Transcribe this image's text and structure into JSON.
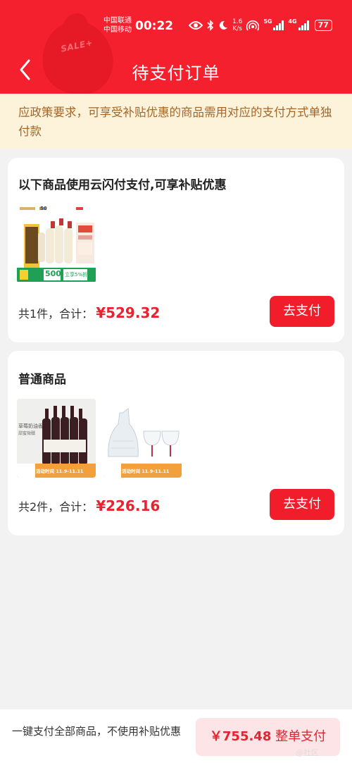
{
  "status_bar": {
    "carrier_1": "中国联通",
    "carrier_2": "中国移动",
    "time": "00:22",
    "speed_value": "1.6",
    "speed_unit": "K/s",
    "net_1": "5G",
    "net_2": "4G",
    "battery": "77"
  },
  "header": {
    "title": "待支付订单",
    "deco_text": "SALE+"
  },
  "notice": {
    "text": "应政策要求，可享受补贴优惠的商品需用对应的支付方式单独付款"
  },
  "orders": [
    {
      "title": "以下商品使用云闪付支付,可享补贴优惠",
      "count_text": "共1件，合计：",
      "price": "¥529.32",
      "pay_label": "去支付",
      "products": [
        {
          "badge_1": "50",
          "promo_1": "500",
          "promo_2": "立享5%折"
        }
      ]
    },
    {
      "title": "普通商品",
      "count_text": "共2件，合计：",
      "price": "¥226.16",
      "pay_label": "去支付",
      "products": [
        {
          "label_top": "草莓奶油香",
          "label_sub": "甜蜜微醺",
          "tag": "活动时间 11.9-11.11"
        },
        {
          "tag": "活动时间 11.9-11.11"
        }
      ]
    }
  ],
  "bottom": {
    "description": "一键支付全部商品，不使用补贴优惠",
    "total": "￥755.48",
    "action_label": "整单支付"
  },
  "watermark": "@社区"
}
